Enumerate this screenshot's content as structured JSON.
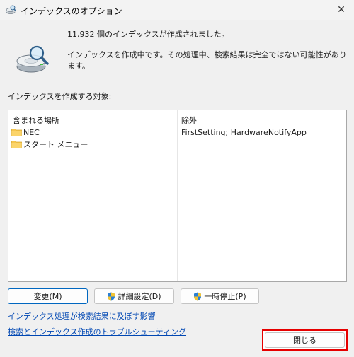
{
  "window": {
    "title": "インデックスのオプション",
    "close_glyph": "✕"
  },
  "status": {
    "count_message": "11,932 個のインデックスが作成されました。",
    "progress_message": "インデックスを作成中です。その処理中、検索結果は完全ではない可能性があります。"
  },
  "locations": {
    "section_label": "インデックスを作成する対象:",
    "col_included": "含まれる場所",
    "col_excluded": "除外",
    "items": [
      {
        "name": "NEC",
        "excluded": "FirstSetting; HardwareNotifyApp"
      },
      {
        "name": "スタート メニュー",
        "excluded": ""
      }
    ]
  },
  "buttons": {
    "modify": "変更(M)",
    "advanced": "詳細設定(D)",
    "pause": "一時停止(P)",
    "close": "閉じる"
  },
  "links": {
    "impact": "インデックス処理が検索結果に及ぼす影響",
    "troubleshoot": "検索とインデックス作成のトラブルシューティング"
  },
  "icons": {
    "window_icon": "indexing-options-icon",
    "status_icon": "drive-magnifier-icon",
    "folder": "folder-icon",
    "shield": "uac-shield-icon"
  }
}
